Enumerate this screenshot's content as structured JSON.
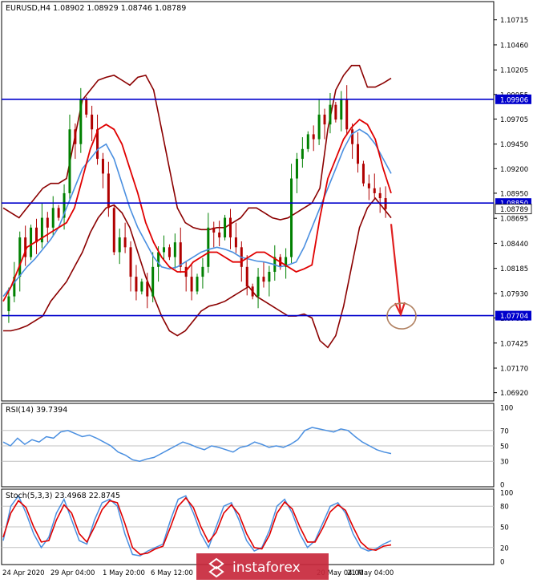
{
  "header": {
    "symbol_line": "EURUSD,H4  1.08902 1.08929 1.08746 1.08789"
  },
  "rsi_header": "RSI(14) 39.7394",
  "stoch_header": "Stoch(5,3,3) 23.4968 22.8745",
  "watermark": "instaforex",
  "colors": {
    "candle_up": "#008000",
    "candle_down": "#b00000",
    "ma_fast": "#e00000",
    "ma_slow": "#4a8fe0",
    "bollinger": "#8b0000",
    "level_line": "#0000cc",
    "arrow": "#e02020",
    "circle": "#b08060",
    "rsi_line": "#4a8fe0",
    "stoch_main": "#4a8fe0",
    "stoch_signal": "#e00000",
    "watermark_bg": "#c8283c"
  },
  "chart_data": [
    {
      "type": "candlestick",
      "title": "EURUSD,H4",
      "ohlc_last": {
        "open": 1.08902,
        "high": 1.08929,
        "low": 1.08746,
        "close": 1.08789
      },
      "ylim": [
        1.068,
        1.0788
      ],
      "y_ticks": [
        "1.10715",
        "1.10460",
        "1.10205",
        "1.09955",
        "1.09705",
        "1.09450",
        "1.09200",
        "1.08950",
        "1.08695",
        "1.08440",
        "1.08185",
        "1.07930",
        "1.07680",
        "1.07425",
        "1.07170",
        "1.06920"
      ],
      "x_ticks": [
        "24 Apr 2020",
        "29 Apr 04:00",
        "1 May 20:00",
        "6 May 12:00",
        "",
        "20 May 04:00",
        "21 May 04:00"
      ],
      "horizontal_levels": [
        {
          "label": "1.09906",
          "value": 1.09906
        },
        {
          "label": "1.08850",
          "value": 1.0885
        },
        {
          "label": "1.07704",
          "value": 1.07704
        }
      ],
      "current_price": {
        "label": "1.08789",
        "value": 1.08789
      },
      "price_path": [
        1.0775,
        1.079,
        1.081,
        1.085,
        1.083,
        1.086,
        1.0845,
        1.087,
        1.086,
        1.088,
        1.087,
        1.0895,
        1.096,
        1.0945,
        1.099,
        1.0975,
        1.096,
        1.093,
        1.0915,
        1.088,
        1.0835,
        1.085,
        1.084,
        1.081,
        1.0795,
        1.0805,
        1.079,
        1.082,
        1.0835,
        1.084,
        1.083,
        1.0845,
        1.082,
        1.081,
        1.0795,
        1.081,
        1.082,
        1.086,
        1.0855,
        1.085,
        1.087,
        1.085,
        1.084,
        1.082,
        1.08,
        1.079,
        1.081,
        1.0805,
        1.0815,
        1.083,
        1.082,
        1.083,
        1.091,
        1.093,
        1.094,
        1.0955,
        1.095,
        1.0975,
        1.0965,
        1.0985,
        1.097,
        1.099,
        1.096,
        1.0945,
        1.0925,
        1.0905,
        1.09,
        1.0895,
        1.089,
        1.08789
      ],
      "bollinger_upper": [
        1.088,
        1.0875,
        1.087,
        1.088,
        1.089,
        1.09,
        1.0905,
        1.0905,
        1.091,
        1.095,
        1.099,
        1.1,
        1.101,
        1.1013,
        1.1015,
        1.101,
        1.1005,
        1.1013,
        1.1015,
        1.1,
        1.096,
        1.092,
        1.088,
        1.0865,
        1.086,
        1.0858,
        1.0858,
        1.086,
        1.086,
        1.0865,
        1.087,
        1.088,
        1.088,
        1.0875,
        1.087,
        1.0868,
        1.087,
        1.0875,
        1.088,
        1.0885,
        1.09,
        1.096,
        1.1,
        1.1015,
        1.1025,
        1.1025,
        1.1003,
        1.1003,
        1.1007,
        1.1012
      ],
      "bollinger_lower": [
        1.0755,
        1.0755,
        1.0757,
        1.076,
        1.0765,
        1.077,
        1.0785,
        1.0795,
        1.0805,
        1.082,
        1.0835,
        1.0855,
        1.087,
        1.088,
        1.0883,
        1.0875,
        1.086,
        1.0835,
        1.081,
        1.079,
        1.077,
        1.0755,
        1.075,
        1.0755,
        1.0765,
        1.0775,
        1.078,
        1.0782,
        1.0785,
        1.079,
        1.0795,
        1.08,
        1.079,
        1.0785,
        1.078,
        1.0775,
        1.077,
        1.077,
        1.0772,
        1.0768,
        1.0745,
        1.0738,
        1.075,
        1.078,
        1.082,
        1.086,
        1.088,
        1.089,
        1.088,
        1.087
      ],
      "ma_fast": [
        1.0785,
        1.08,
        1.082,
        1.084,
        1.0845,
        1.085,
        1.0855,
        1.086,
        1.0865,
        1.088,
        1.091,
        1.094,
        1.096,
        1.0965,
        1.096,
        1.0945,
        1.092,
        1.0895,
        1.0865,
        1.0845,
        1.083,
        1.082,
        1.0815,
        1.0815,
        1.0825,
        1.083,
        1.0835,
        1.0835,
        1.083,
        1.0825,
        1.0825,
        1.083,
        1.0835,
        1.0835,
        1.083,
        1.0825,
        1.082,
        1.0815,
        1.0818,
        1.0822,
        1.087,
        1.091,
        1.093,
        1.095,
        1.0962,
        1.097,
        1.0965,
        1.095,
        1.092,
        1.0895
      ],
      "ma_slow": [
        1.079,
        1.08,
        1.081,
        1.082,
        1.0828,
        1.0838,
        1.0848,
        1.086,
        1.088,
        1.09,
        1.092,
        1.093,
        1.094,
        1.0945,
        1.093,
        1.0905,
        1.088,
        1.086,
        1.0845,
        1.083,
        1.082,
        1.0818,
        1.082,
        1.0825,
        1.083,
        1.0835,
        1.0838,
        1.084,
        1.0838,
        1.0835,
        1.083,
        1.0828,
        1.0826,
        1.0825,
        1.0823,
        1.082,
        1.0822,
        1.0825,
        1.084,
        1.086,
        1.088,
        1.09,
        1.092,
        1.094,
        1.0955,
        1.096,
        1.0955,
        1.0945,
        1.093,
        1.0915
      ],
      "projection": {
        "from": 1.088,
        "to": 1.077
      }
    },
    {
      "type": "line",
      "title": "RSI(14) 39.7394",
      "ylim": [
        0,
        100
      ],
      "y_ticks": [
        "100",
        "70",
        "50",
        "30",
        "0"
      ],
      "values": [
        55,
        50,
        60,
        52,
        58,
        55,
        62,
        60,
        68,
        70,
        66,
        62,
        64,
        60,
        55,
        50,
        42,
        38,
        32,
        30,
        33,
        35,
        40,
        45,
        50,
        55,
        52,
        48,
        45,
        50,
        48,
        45,
        42,
        48,
        50,
        55,
        52,
        48,
        50,
        48,
        52,
        58,
        70,
        74,
        72,
        70,
        68,
        72,
        70,
        62,
        55,
        50,
        45,
        42,
        40
      ]
    },
    {
      "type": "line",
      "title": "Stoch(5,3,3) 23.4968 22.8745",
      "ylim": [
        0,
        100
      ],
      "y_ticks": [
        "100",
        "80",
        "50",
        "20",
        "0"
      ],
      "series": [
        {
          "values": [
            30,
            80,
            95,
            70,
            40,
            20,
            35,
            70,
            90,
            60,
            30,
            25,
            60,
            85,
            90,
            80,
            40,
            10,
            8,
            15,
            20,
            25,
            60,
            90,
            95,
            70,
            40,
            20,
            50,
            80,
            85,
            60,
            30,
            15,
            20,
            45,
            80,
            90,
            70,
            40,
            20,
            30,
            55,
            80,
            85,
            70,
            40,
            20,
            15,
            18,
            25,
            30
          ]
        },
        {
          "values": [
            35,
            70,
            88,
            78,
            50,
            28,
            30,
            60,
            82,
            70,
            40,
            28,
            50,
            75,
            88,
            85,
            55,
            20,
            10,
            12,
            18,
            22,
            50,
            80,
            92,
            78,
            50,
            28,
            42,
            70,
            82,
            68,
            40,
            20,
            18,
            38,
            70,
            86,
            76,
            50,
            28,
            28,
            48,
            72,
            82,
            74,
            50,
            28,
            18,
            16,
            22,
            24
          ]
        }
      ]
    }
  ]
}
